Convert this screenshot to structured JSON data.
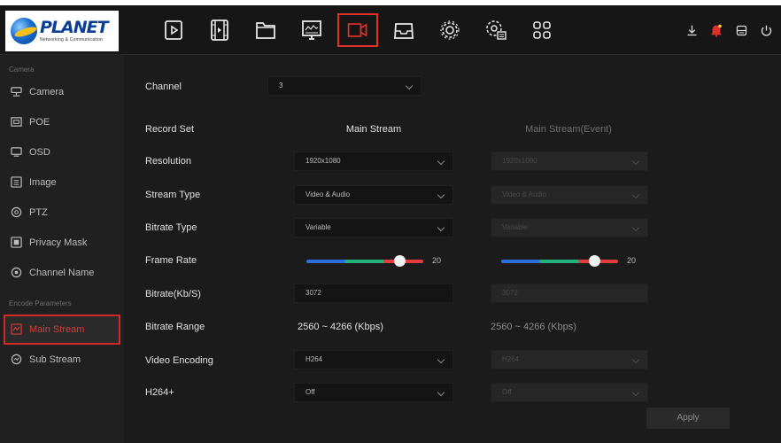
{
  "brand": {
    "name": "PLANET",
    "tagline": "Networking & Communication"
  },
  "topbar": {
    "nav": [
      {
        "name": "playback-icon"
      },
      {
        "name": "video-clip-icon"
      },
      {
        "name": "folder-icon"
      },
      {
        "name": "monitor-icon"
      },
      {
        "name": "record-camera-icon",
        "active": true
      },
      {
        "name": "storage-drive-icon"
      },
      {
        "name": "settings-gear-icon"
      },
      {
        "name": "system-settings-icon"
      },
      {
        "name": "apps-grid-icon"
      }
    ],
    "right": [
      "download-icon",
      "alarm-bell-icon",
      "device-icon",
      "power-icon"
    ]
  },
  "sidebar": {
    "section_camera": "Camera",
    "camera_items": [
      {
        "label": "Camera",
        "icon": "camera-icon"
      },
      {
        "label": "POE",
        "icon": "poe-icon"
      },
      {
        "label": "OSD",
        "icon": "osd-icon"
      },
      {
        "label": "Image",
        "icon": "image-icon"
      },
      {
        "label": "PTZ",
        "icon": "ptz-icon"
      },
      {
        "label": "Privacy Mask",
        "icon": "privacy-mask-icon"
      },
      {
        "label": "Channel Name",
        "icon": "channel-name-icon"
      }
    ],
    "section_encode": "Encode Parameters",
    "encode_items": [
      {
        "label": "Main Stream",
        "icon": "main-stream-icon",
        "active": true
      },
      {
        "label": "Sub Stream",
        "icon": "sub-stream-icon"
      }
    ]
  },
  "main": {
    "channel": {
      "label": "Channel",
      "value": "3"
    },
    "record_set": {
      "label": "Record Set",
      "col_main": "Main Stream",
      "col_event": "Main Stream(Event)"
    },
    "resolution": {
      "label": "Resolution",
      "main": "1920x1080",
      "event": "1920x1080"
    },
    "stream_type": {
      "label": "Stream Type",
      "main": "Video & Audio",
      "event": "Video & Audio"
    },
    "bitrate_type": {
      "label": "Bitrate Type",
      "main": "Variable",
      "event": "Variable"
    },
    "frame_rate": {
      "label": "Frame Rate",
      "main": "20",
      "event": "20",
      "max": 25
    },
    "bitrate": {
      "label": "Bitrate(Kb/S)",
      "main": "3072",
      "event": "3072"
    },
    "bitrate_range": {
      "label": "Bitrate Range",
      "main": "2560 ~ 4266 (Kbps)",
      "event": "2560 ~ 4266 (Kbps)"
    },
    "video_encoding": {
      "label": "Video Encoding",
      "main": "H264",
      "event": "H264"
    },
    "h264plus": {
      "label": "H264+",
      "main": "Off",
      "event": "Off"
    },
    "apply_label": "Apply"
  },
  "colors": {
    "accent": "#e0302a",
    "background": "#1b1b1b",
    "sidebar": "#202020"
  }
}
